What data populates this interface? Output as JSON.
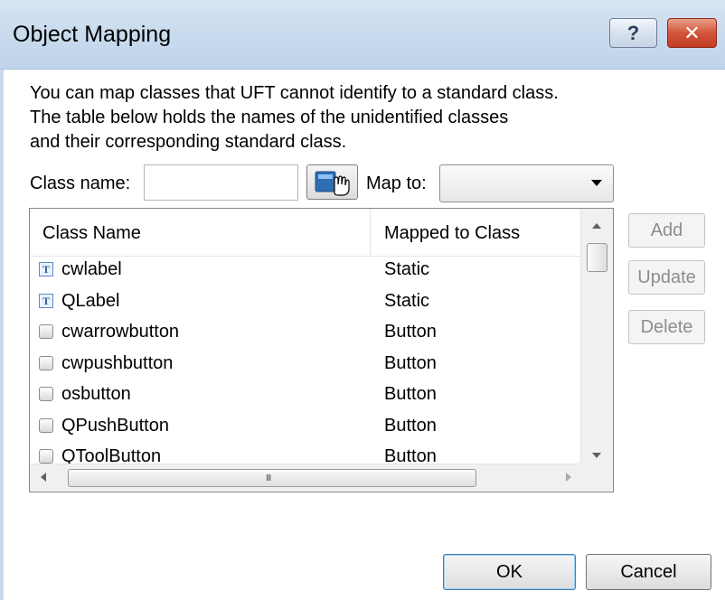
{
  "window": {
    "title": "Object Mapping",
    "help_glyph": "?",
    "close_glyph": "✕"
  },
  "description": {
    "line1": "You can map classes that UFT cannot identify to a standard class.",
    "line2": "The table below holds the names of the unidentified classes",
    "line3": "and their corresponding standard class."
  },
  "form": {
    "class_name_label": "Class name:",
    "class_name_value": "",
    "map_to_label": "Map to:",
    "map_to_value": ""
  },
  "table": {
    "headers": [
      "Class Name",
      "Mapped to Class"
    ],
    "rows": [
      {
        "name": "cwlabel",
        "mapped": "Static",
        "icon": "text-control-icon"
      },
      {
        "name": "QLabel",
        "mapped": "Static",
        "icon": "text-control-icon"
      },
      {
        "name": "cwarrowbutton",
        "mapped": "Button",
        "icon": "button-control-icon"
      },
      {
        "name": "cwpushbutton",
        "mapped": "Button",
        "icon": "button-control-icon"
      },
      {
        "name": "osbutton",
        "mapped": "Button",
        "icon": "button-control-icon"
      },
      {
        "name": "QPushButton",
        "mapped": "Button",
        "icon": "button-control-icon"
      },
      {
        "name": "QToolButton",
        "mapped": "Button",
        "icon": "button-control-icon"
      }
    ],
    "scroll_grip": "III"
  },
  "side_buttons": {
    "add": "Add",
    "update": "Update",
    "delete": "Delete"
  },
  "footer": {
    "ok": "OK",
    "cancel": "Cancel"
  },
  "colors": {
    "titlebar": "#c9dbee",
    "close_button": "#c23a22",
    "disabled_text": "#8d8d8d"
  }
}
